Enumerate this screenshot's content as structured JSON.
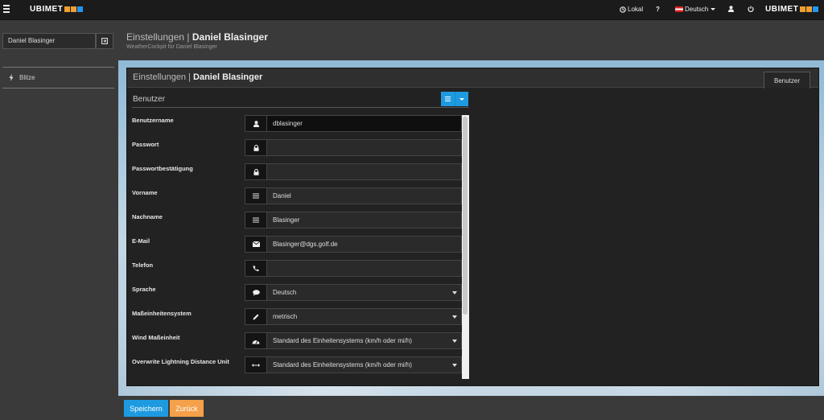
{
  "topnav": {
    "logo_text": "UBIMET",
    "logo_tile_colors": [
      "#f0a030",
      "#f0a030",
      "#2196f3"
    ],
    "local_label": "Lokal",
    "help_label": "?",
    "language_label": "Deutsch",
    "icons": [
      "menu-icon",
      "clock-icon",
      "flag-icon",
      "user-icon",
      "power-icon"
    ]
  },
  "sidebar": {
    "user_name": "Daniel Blasinger",
    "items": [
      {
        "label": "Blitze",
        "icon": "lightning-icon"
      }
    ]
  },
  "page": {
    "title_prefix": "Einstellungen |",
    "title_name": "Daniel Blasinger",
    "subtitle": "WeatherCockpit für Daniel Blasinger"
  },
  "panel": {
    "title_prefix": "Einstellungen |",
    "title_name": "Daniel Blasinger",
    "tab_label": "Benutzer",
    "section_title": "Benutzer"
  },
  "form": {
    "fields": [
      {
        "label": "Benutzername",
        "value": "dblasinger",
        "icon": "user-icon"
      },
      {
        "label": "Passwort",
        "value": "",
        "icon": "lock-icon"
      },
      {
        "label": "Passwortbestätigung",
        "value": "",
        "icon": "lock-icon"
      },
      {
        "label": "Vorname",
        "value": "Daniel",
        "icon": "list-icon"
      },
      {
        "label": "Nachname",
        "value": "Blasinger",
        "icon": "list-icon"
      },
      {
        "label": "E-Mail",
        "value": "Blasinger@dgs.golf.de",
        "icon": "envelope-icon"
      },
      {
        "label": "Telefon",
        "value": "",
        "icon": "phone-icon"
      },
      {
        "label": "Sprache",
        "value": "Deutsch",
        "icon": "comment-icon"
      },
      {
        "label": "Maßeinheitensystem",
        "value": "metrisch",
        "icon": "pencil-icon"
      },
      {
        "label": "Wind Maßeinheit",
        "value": "Standard des Einheitensystems (km/h oder mi/h)",
        "icon": "gauge-icon"
      },
      {
        "label": "Overwrite Lightning Distance Unit",
        "value": "Standard des Einheitensystems (km/h oder mi/h)",
        "icon": "arrows-horizontal-icon"
      }
    ]
  },
  "footer": {
    "save_label": "Speichern",
    "back_label": "Zurück"
  },
  "colors": {
    "primary": "#1e9be0",
    "warning": "#f5a04a",
    "nav_bg": "#1b1b1b",
    "panel_bg": "#222222"
  }
}
